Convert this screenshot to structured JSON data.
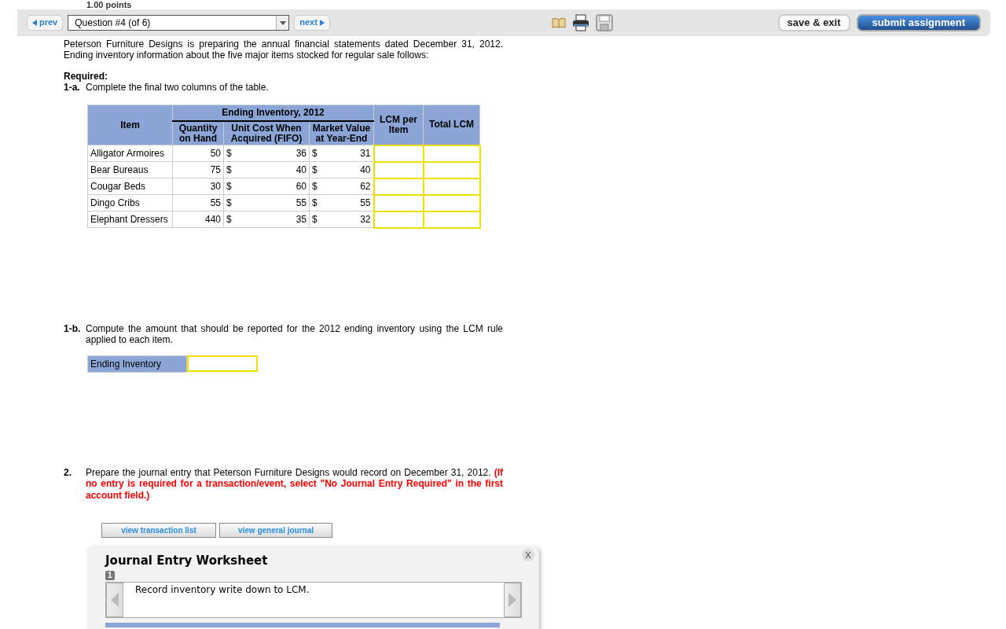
{
  "points": "1.00 points",
  "toolbar": {
    "prev": "prev",
    "question_select": "Question #4 (of 6)",
    "next": "next",
    "save": "save & exit",
    "submit": "submit assignment"
  },
  "intro": "Peterson Furniture Designs is preparing the annual financial statements dated December 31, 2012. Ending inventory information about the five major items stocked for regular sale follows:",
  "required_label": "Required:",
  "part_1a": {
    "number": "1-a.",
    "text": "Complete the final two columns of the table."
  },
  "table": {
    "group_header": "Ending Inventory, 2012",
    "columns": [
      "Item",
      "Quantity on Hand",
      "Unit Cost When Acquired (FIFO)",
      "Market Value at Year-End",
      "LCM per Item",
      "Total LCM"
    ],
    "rows": [
      {
        "item": "Alligator Armoires",
        "quantity": "50",
        "cost_currency": "$",
        "cost": "36",
        "market_currency": "$",
        "market": "31"
      },
      {
        "item": "Bear Bureaus",
        "quantity": "75",
        "cost_currency": "$",
        "cost": "40",
        "market_currency": "$",
        "market": "40"
      },
      {
        "item": "Cougar Beds",
        "quantity": "30",
        "cost_currency": "$",
        "cost": "60",
        "market_currency": "$",
        "market": "62"
      },
      {
        "item": "Dingo Cribs",
        "quantity": "55",
        "cost_currency": "$",
        "cost": "55",
        "market_currency": "$",
        "market": "55"
      },
      {
        "item": "Elephant Dressers",
        "quantity": "440",
        "cost_currency": "$",
        "cost": "35",
        "market_currency": "$",
        "market": "32"
      }
    ]
  },
  "part_1b": {
    "number": "1-b.",
    "text": "Compute the amount that should be reported for the 2012 ending inventory using the LCM rule applied to each item.",
    "field_label": "Ending Inventory"
  },
  "part_2": {
    "number": "2.",
    "text": "Prepare the journal entry that Peterson Furniture Designs would record on December 31, 2012.",
    "note": "(If no entry is required for a transaction/event, select \"No Journal Entry Required\" in the first account field.)"
  },
  "buttons": [
    "view transaction list",
    "view general journal"
  ],
  "worksheet": {
    "title": "Journal Entry Worksheet",
    "close": "X",
    "entry_number": "1",
    "description": "Record inventory write down to LCM."
  }
}
